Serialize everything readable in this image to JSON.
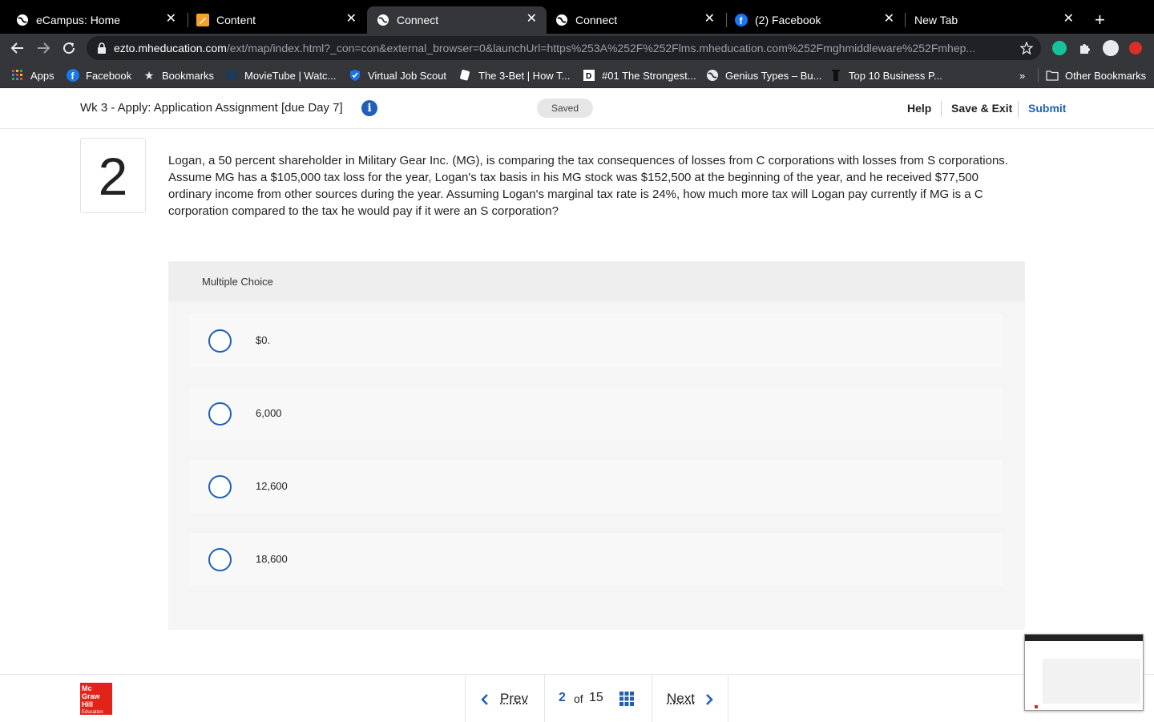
{
  "browser": {
    "tabs": [
      {
        "title": "eCampus: Home",
        "icon": "globe-icon"
      },
      {
        "title": "Content",
        "icon": "pencil-icon"
      },
      {
        "title": "Connect",
        "icon": "globe-icon",
        "active": true
      },
      {
        "title": "Connect",
        "icon": "globe-icon"
      },
      {
        "title": "(2) Facebook",
        "icon": "facebook-icon"
      },
      {
        "title": "New Tab",
        "icon": ""
      }
    ],
    "url_host": "ezto.mheducation.com",
    "url_path": "/ext/map/index.html?_con=con&external_browser=0&launchUrl=https%253A%252F%252Flms.mheducation.com%252Fmghmiddleware%252Fmhep...",
    "bookmarks": [
      {
        "label": "Apps",
        "icon": "apps-grid-icon"
      },
      {
        "label": "Facebook",
        "icon": "facebook-icon"
      },
      {
        "label": "Bookmarks",
        "icon": "star-icon"
      },
      {
        "label": "MovieTube | Watc...",
        "icon": "movietube-icon"
      },
      {
        "label": "Virtual Job Scout",
        "icon": "check-shield-icon"
      },
      {
        "label": "The 3-Bet | How T...",
        "icon": "cards-icon"
      },
      {
        "label": "#01 The Strongest...",
        "icon": "d-square-icon"
      },
      {
        "label": "Genius Types – Bu...",
        "icon": "globe-icon"
      },
      {
        "label": "Top 10 Business P...",
        "icon": "bookmark-black-icon"
      }
    ],
    "other_bookmarks": "Other Bookmarks"
  },
  "header": {
    "assignment_title": "Wk 3 - Apply: Application Assignment [due Day 7]",
    "info_glyph": "i",
    "saved_label": "Saved",
    "help": "Help",
    "save_exit": "Save & Exit",
    "submit": "Submit"
  },
  "question": {
    "number": "2",
    "text": "Logan, a 50 percent shareholder in Military Gear Inc. (MG), is comparing the tax consequences of losses from C corporations with losses from S corporations. Assume MG has a $105,000 tax loss for the year, Logan's tax basis in his MG stock was $152,500 at the beginning of the year, and he received $77,500 ordinary income from other sources during the year. Assuming Logan's marginal tax rate is 24%, how much more tax will Logan pay currently if MG is a C corporation compared to the tax he would pay if it were an S corporation?",
    "type_label": "Multiple Choice",
    "choices": [
      "$0.",
      "6,000",
      "12,600",
      "18,600"
    ]
  },
  "footer": {
    "logo_lines": [
      "Mc",
      "Graw",
      "Hill",
      "Education"
    ],
    "prev": "Prev",
    "current_page": "2",
    "of_label": "of",
    "total_pages": "15",
    "next": "Next"
  },
  "colors": {
    "accent_blue": "#1f5fb8",
    "brand_red": "#e2231a"
  }
}
